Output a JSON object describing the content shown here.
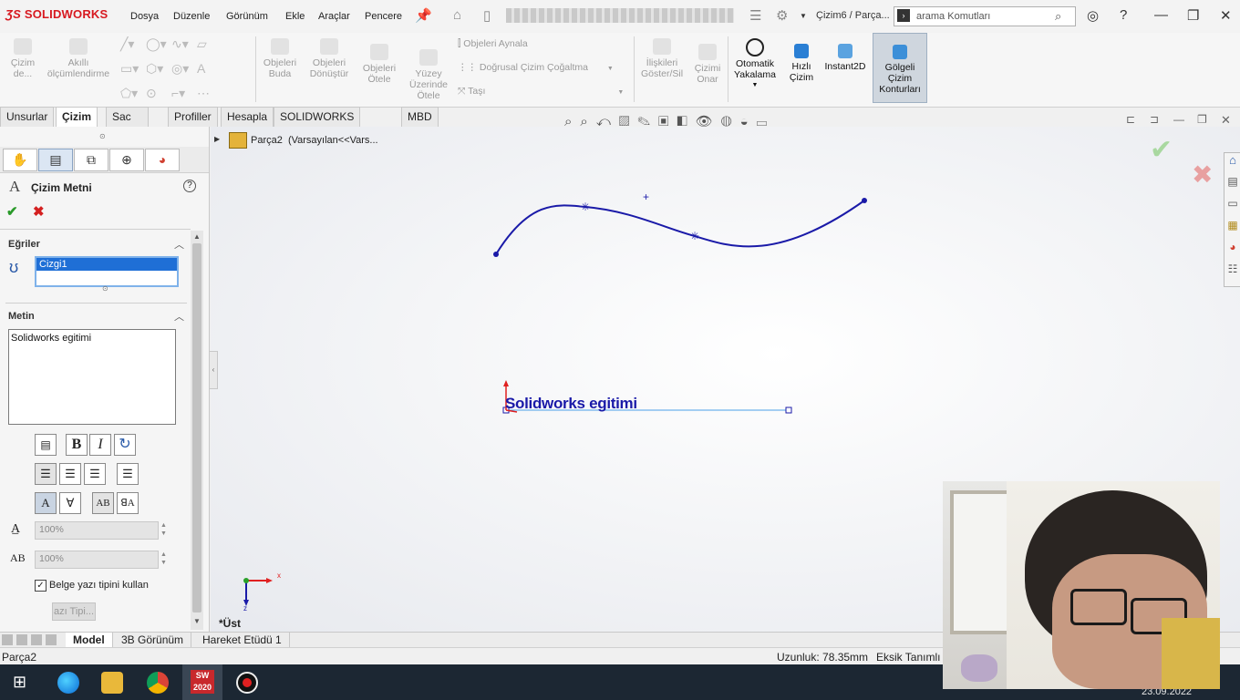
{
  "app": {
    "logo": "SOLIDWORKS",
    "title": "Çizim6 / Parça...",
    "search_placeholder": "arama Komutları"
  },
  "menu": [
    "Dosya",
    "Düzenle",
    "Görünüm",
    "Ekle",
    "Araçlar",
    "Pencere"
  ],
  "command_manager": [
    {
      "label": "Çizim de...",
      "enabled": false
    },
    {
      "label": "Akıllı ölçümlendirme",
      "enabled": false
    },
    {
      "label": "Objeleri Buda",
      "enabled": false
    },
    {
      "label": "Objeleri Dönüştür",
      "enabled": false
    },
    {
      "label": "Objeleri Ötele",
      "enabled": false
    },
    {
      "label": "Yüzey Üzerinde Ötele",
      "enabled": false
    },
    {
      "label": "Objeleri Aynala",
      "enabled": false
    },
    {
      "label": "Doğrusal Çizim Çoğaltma",
      "enabled": false
    },
    {
      "label": "Taşı",
      "enabled": false
    },
    {
      "label": "İlişkileri Göster/Sil",
      "enabled": false
    },
    {
      "label": "Çizimi Onar",
      "enabled": false
    },
    {
      "label": "Otomatik Yakalama",
      "enabled": true
    },
    {
      "label": "Hızlı Çizim",
      "enabled": true
    },
    {
      "label": "Instant2D",
      "enabled": true
    },
    {
      "label": "Gölgeli Çizim Konturları",
      "enabled": true
    }
  ],
  "tabs": [
    "Unsurlar",
    "Çizim",
    "Sac Levha",
    "Profiller",
    "Hesapla",
    "SOLIDWORKS Eklentileri",
    "MBD"
  ],
  "active_tab": "Çizim",
  "feature_tree": {
    "root": "Parça2  (Varsayılan<<Vars..."
  },
  "property_manager": {
    "title": "Çizim Metni",
    "curves_header": "Eğriler",
    "curve_item": "Cizgi1",
    "text_header": "Metin",
    "text_value": "Solidworks egitimi",
    "width_value": "100%",
    "spacing_value": "100%",
    "use_doc_font_label": "Belge yazı tipini kullan",
    "use_doc_font_checked": true,
    "font_button": "azı Tipi..."
  },
  "viewport": {
    "sketch_text": "Solidworks egitimi",
    "view_label": "*Üst",
    "triad": {
      "x": "x",
      "z": "z"
    }
  },
  "bottom_tabs": [
    "Model",
    "3B Görünüm",
    "Hareket Etüdü 1"
  ],
  "active_bottom_tab": "Model",
  "status": {
    "part_name": "Parça2",
    "length": "Uzunluk: 78.35mm",
    "constraint": "Eksik Tanımlı"
  },
  "taskbar": {
    "date": "23.09.2022",
    "sw_badge": "2020"
  },
  "colors": {
    "sketch_blue": "#1a1aa8",
    "accent_red": "#d71920",
    "highlight": "#1f6fd6"
  }
}
